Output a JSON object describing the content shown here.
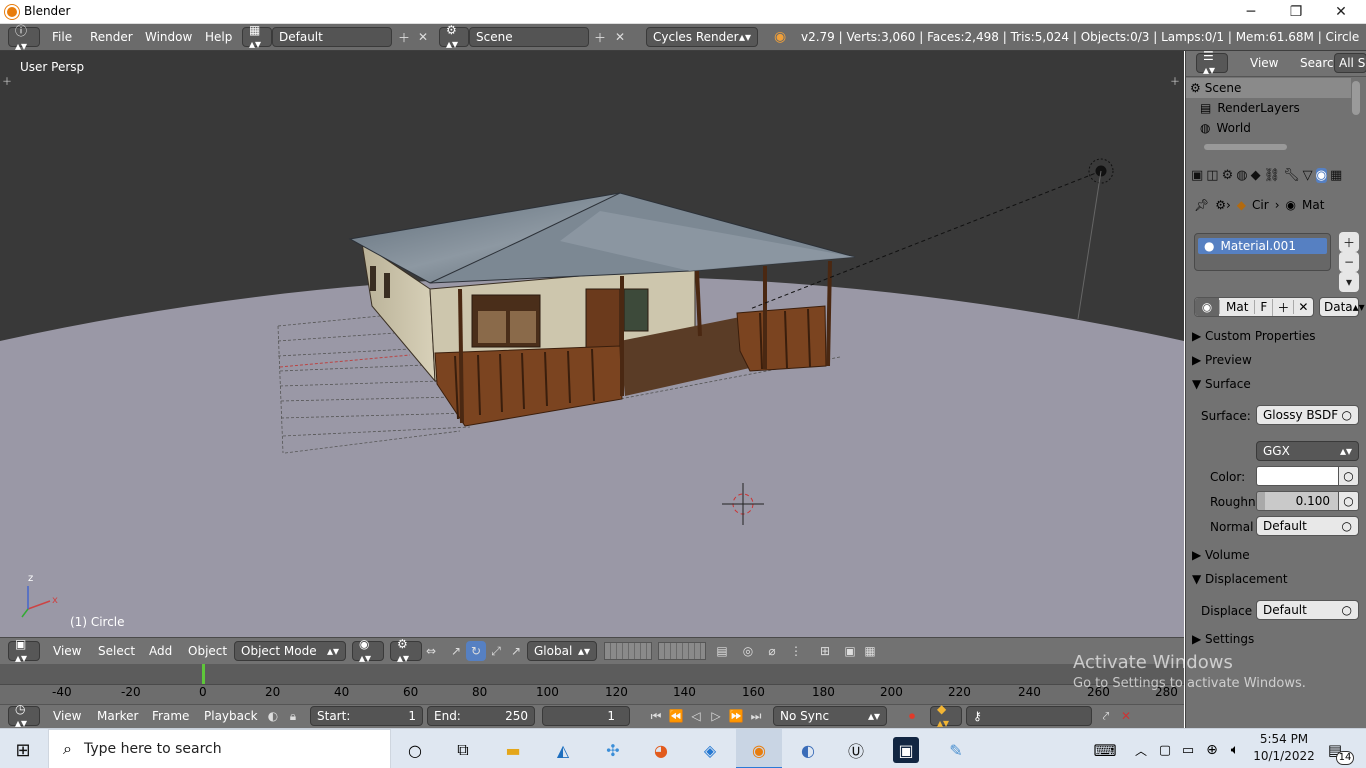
{
  "window": {
    "title": "Blender",
    "minimize": "─",
    "maximize": "❐",
    "close": "✕"
  },
  "info_header": {
    "menus": [
      "File",
      "Render",
      "Window",
      "Help"
    ],
    "screen_layout": "Default",
    "scene": "Scene",
    "render_engine": "Cycles Render",
    "stats": "v2.79 | Verts:3,060 | Faces:2,498 | Tris:5,024 | Objects:0/3 | Lamps:0/1 | Mem:61.68M | Circle"
  },
  "viewport": {
    "view_label": "User Persp",
    "object_label": "(1) Circle",
    "axis_x": "x",
    "axis_z": "z",
    "bg_color": "#393939",
    "ground_color": "#9a98a6"
  },
  "viewport_header": {
    "menus": [
      "View",
      "Select",
      "Add",
      "Object"
    ],
    "mode": "Object Mode",
    "orientation": "Global"
  },
  "timeline": {
    "ticks": [
      "-40",
      "-20",
      "0",
      "20",
      "40",
      "60",
      "80",
      "100",
      "120",
      "140",
      "160",
      "180",
      "200",
      "220",
      "240",
      "260",
      "280"
    ],
    "menus": [
      "View",
      "Marker",
      "Frame",
      "Playback"
    ],
    "start_label": "Start:",
    "start_value": "1",
    "end_label": "End:",
    "end_value": "250",
    "current_frame": "1",
    "sync": "No Sync"
  },
  "watermark": {
    "line1": "Activate Windows",
    "line2": "Go to Settings to activate Windows."
  },
  "outliner": {
    "menus": [
      "View",
      "Search"
    ],
    "filter": "All Sc",
    "items": [
      "Scene",
      "RenderLayers",
      "World"
    ]
  },
  "properties": {
    "breadcrumb_object": "Cir",
    "breadcrumb_material": "Mat",
    "material_slot": "Material.001",
    "datablock_name": "Mat",
    "datablock_f": "F",
    "link_type": "Data",
    "panels": {
      "custom_properties": "Custom Properties",
      "preview": "Preview",
      "surface": "Surface",
      "volume": "Volume",
      "displacement": "Displacement",
      "settings": "Settings"
    },
    "surface_label": "Surface:",
    "surface_value": "Glossy BSDF",
    "distribution": "GGX",
    "color_label": "Color:",
    "color_value": "#ffffff",
    "roughness_label": "Roughn",
    "roughness_value": "0.100",
    "normal_label": "Normal",
    "normal_value": "Default",
    "displace_label": "Displace",
    "displace_value": "Default"
  },
  "taskbar": {
    "search_placeholder": "Type here to search",
    "time": "5:54 PM",
    "date": "10/1/2022",
    "notifications": "14"
  }
}
